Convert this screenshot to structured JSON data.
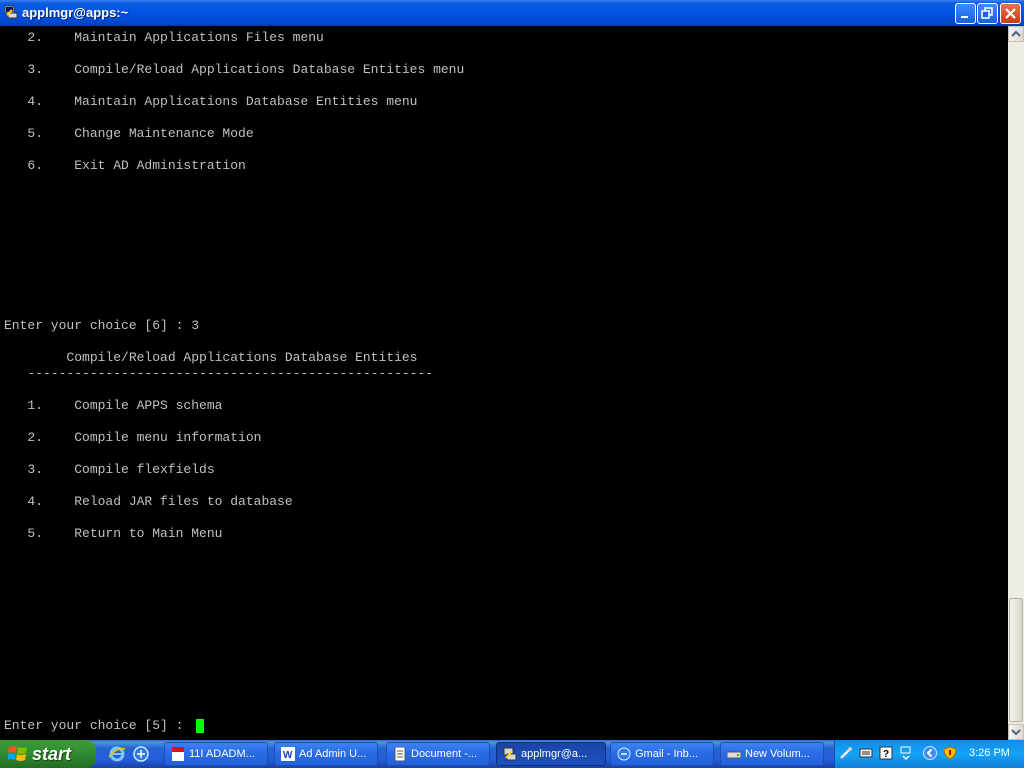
{
  "window": {
    "title": "applmgr@apps:~"
  },
  "terminal": {
    "lines": [
      "   2.    Maintain Applications Files menu",
      "   3.    Compile/Reload Applications Database Entities menu",
      "   4.    Maintain Applications Database Entities menu",
      "   5.    Change Maintenance Mode",
      "   6.    Exit AD Administration",
      "Enter your choice [6] : 3",
      "        Compile/Reload Applications Database Entities",
      "   ----------------------------------------------------",
      "   1.    Compile APPS schema",
      "   2.    Compile menu information",
      "   3.    Compile flexfields",
      "   4.    Reload JAR files to database",
      "   5.    Return to Main Menu",
      "Enter your choice [5] : "
    ]
  },
  "taskbar": {
    "start_label": "start",
    "tasks": [
      {
        "label": "11I ADADM...",
        "icon": "pdf-icon"
      },
      {
        "label": "Ad Admin U...",
        "icon": "word-icon"
      },
      {
        "label": "Document -...",
        "icon": "document-icon"
      },
      {
        "label": "applmgr@a...",
        "icon": "putty-icon"
      },
      {
        "label": "Gmail - Inb...",
        "icon": "gmail-icon"
      },
      {
        "label": "New Volum...",
        "icon": "drive-icon"
      }
    ],
    "clock": "3:26 PM"
  },
  "colors": {
    "terminal_bg": "#000000",
    "terminal_fg": "#c0c0c0",
    "cursor": "#00ff00",
    "titlebar": "#0153e3",
    "start": "#2f8b2f"
  }
}
